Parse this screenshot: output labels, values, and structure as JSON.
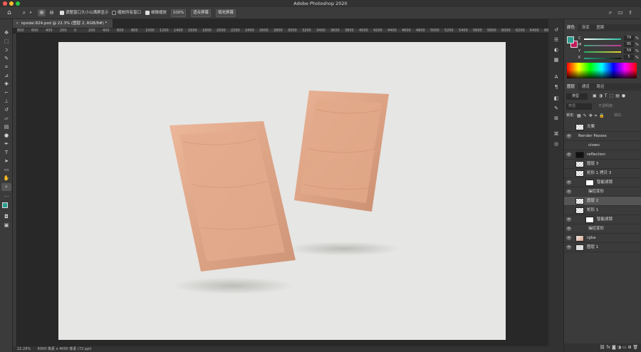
{
  "app": {
    "title": "Adobe Photoshop 2020"
  },
  "options": {
    "checkbox1": "调整窗口大小以满屏显示",
    "checkbox2": "缩放所有窗口",
    "checkbox3": "细微缩放",
    "zoom_value": "100%",
    "fit_screen": "适合屏幕",
    "fill_screen": "填充屏幕"
  },
  "document": {
    "tab_title": "npzdai.824.psd @ 22.3% (图层 2, RGB/8#) *"
  },
  "ruler": {
    "ticks": [
      "800",
      "600",
      "400",
      "200",
      "0",
      "200",
      "400",
      "600",
      "800",
      "1000",
      "1200",
      "1400",
      "1600",
      "1800",
      "2000",
      "2200",
      "2400",
      "2600",
      "2800",
      "3000",
      "3200",
      "3400",
      "3600",
      "3800",
      "4000",
      "4200",
      "4400",
      "4600",
      "4800",
      "5000",
      "5200",
      "5400",
      "5600",
      "5800",
      "6000",
      "6200",
      "6400",
      "6600"
    ]
  },
  "status": {
    "zoom": "22.29%",
    "doc_size": "6000 像素 x 4000 像素 (72 ppi)"
  },
  "color_panel": {
    "tabs": [
      "颜色",
      "渐变",
      "图案"
    ],
    "sliders": [
      {
        "label": "C",
        "value": "79",
        "unit": "%",
        "color": "#2ec0a6"
      },
      {
        "label": "M",
        "value": "95",
        "unit": "%",
        "color": "#d0309a"
      },
      {
        "label": "Y",
        "value": "59",
        "unit": "%",
        "color": "#e6d02a"
      },
      {
        "label": "K",
        "value": "5",
        "unit": "%",
        "color": "#555555"
      }
    ],
    "foreground": "#2a9d8f",
    "background": "#c2185b"
  },
  "layers_panel": {
    "tabs": [
      "图层",
      "通道",
      "路径"
    ],
    "filter_label": "类型",
    "blend_mode": "穿透",
    "opacity_label": "不透明度:",
    "lock_label": "锁定:",
    "fill_label": "填充:",
    "layers": [
      {
        "name": "文案",
        "visible": false,
        "indent": 0
      },
      {
        "name": "Render Passes",
        "visible": true,
        "indent": 0
      },
      {
        "name": "clown",
        "visible": false,
        "indent": 1
      },
      {
        "name": "reflection",
        "visible": true,
        "indent": 0
      },
      {
        "name": "图层 3",
        "visible": false,
        "indent": 0
      },
      {
        "name": "矩形 1 拷贝 3",
        "visible": false,
        "indent": 0
      },
      {
        "name": "智能滤镜",
        "visible": true,
        "indent": 1
      },
      {
        "name": "操控变形",
        "visible": true,
        "indent": 1
      },
      {
        "name": "图层 2",
        "visible": false,
        "indent": 0
      },
      {
        "name": "矩形 1",
        "visible": false,
        "indent": 0
      },
      {
        "name": "智能滤镜",
        "visible": true,
        "indent": 1
      },
      {
        "name": "操控变形",
        "visible": true,
        "indent": 1
      },
      {
        "name": "rgba",
        "visible": true,
        "indent": 0
      },
      {
        "name": "图层 1",
        "visible": true,
        "indent": 0
      }
    ]
  }
}
